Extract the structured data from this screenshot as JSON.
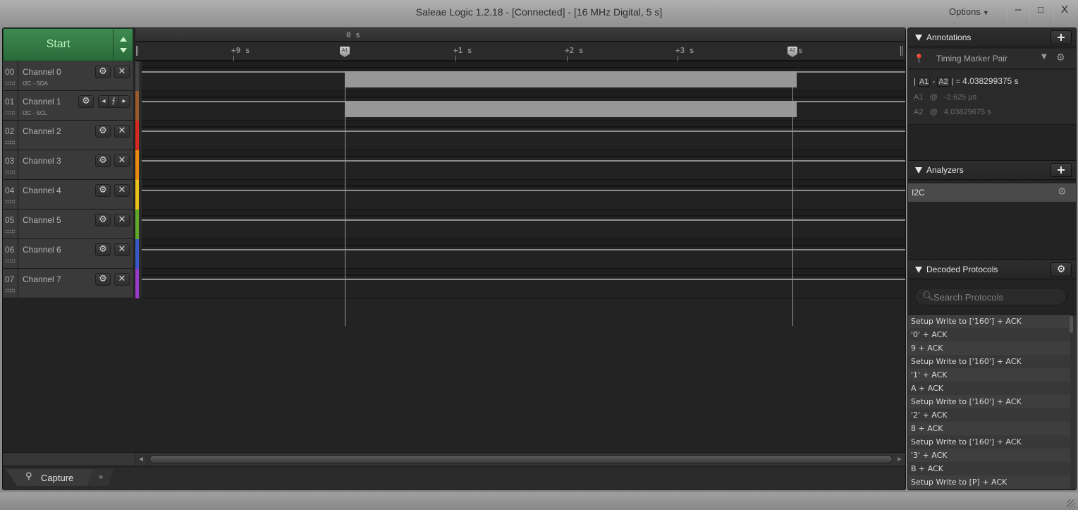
{
  "window": {
    "title": "Saleae Logic 1.2.18 - [Connected] - [16 MHz Digital, 5 s]",
    "options_label": "Options",
    "minimize_label": "–",
    "maximize_label": "□",
    "close_label": "X"
  },
  "toolbar": {
    "start_label": "Start"
  },
  "timeline": {
    "origin_label": "0 s",
    "ticks": [
      "+9 s",
      "+1 s",
      "+2 s",
      "+3 s"
    ],
    "markers": [
      {
        "id": "A1",
        "label": "A1"
      },
      {
        "id": "A2",
        "label": "A2",
        "suffix": "s"
      }
    ]
  },
  "channels": [
    {
      "num": "00",
      "name": "Channel 0",
      "sub": "I2C - SDA",
      "color": "#444444",
      "activity": true
    },
    {
      "num": "01",
      "name": "Channel 1",
      "sub": "I2C - SCL",
      "color": "#9a5a2c",
      "activity": true,
      "trigger": true
    },
    {
      "num": "02",
      "name": "Channel 2",
      "sub": "",
      "color": "#d42a22",
      "activity": false
    },
    {
      "num": "03",
      "name": "Channel 3",
      "sub": "",
      "color": "#e88a12",
      "activity": false
    },
    {
      "num": "04",
      "name": "Channel 4",
      "sub": "",
      "color": "#e8c218",
      "activity": false
    },
    {
      "num": "05",
      "name": "Channel 5",
      "sub": "",
      "color": "#5fa82a",
      "activity": false
    },
    {
      "num": "06",
      "name": "Channel 6",
      "sub": "",
      "color": "#3a58c8",
      "activity": false
    },
    {
      "num": "07",
      "name": "Channel 7",
      "sub": "",
      "color": "#9a3ac8",
      "activity": false
    }
  ],
  "bottom_tabs": {
    "capture_label": "Capture",
    "more_label": "»"
  },
  "annotations": {
    "title": "Annotations",
    "add_label": "+",
    "marker_pair_label": "Timing Marker Pair",
    "diff_a": "A1",
    "diff_b": "A2",
    "diff_value": "4.038299375 s",
    "a1_label": "A1",
    "a1_at": "@",
    "a1_value": "-2.625 µs",
    "a2_label": "A2",
    "a2_at": "@",
    "a2_value": "4.03829675 s"
  },
  "analyzers": {
    "title": "Analyzers",
    "add_label": "+",
    "items": [
      {
        "name": "I2C"
      }
    ]
  },
  "decoded": {
    "title": "Decoded Protocols",
    "search_placeholder": "Search Protocols",
    "search_value": "",
    "items": [
      "Setup Write to ['160'] + ACK",
      "'0' + ACK",
      "9 + ACK",
      "Setup Write to ['160'] + ACK",
      "'1' + ACK",
      "A + ACK",
      "Setup Write to ['160'] + ACK",
      "'2' + ACK",
      "8 + ACK",
      "Setup Write to ['160'] + ACK",
      "'3' + ACK",
      "B + ACK",
      "Setup Write to [P] + ACK"
    ]
  }
}
